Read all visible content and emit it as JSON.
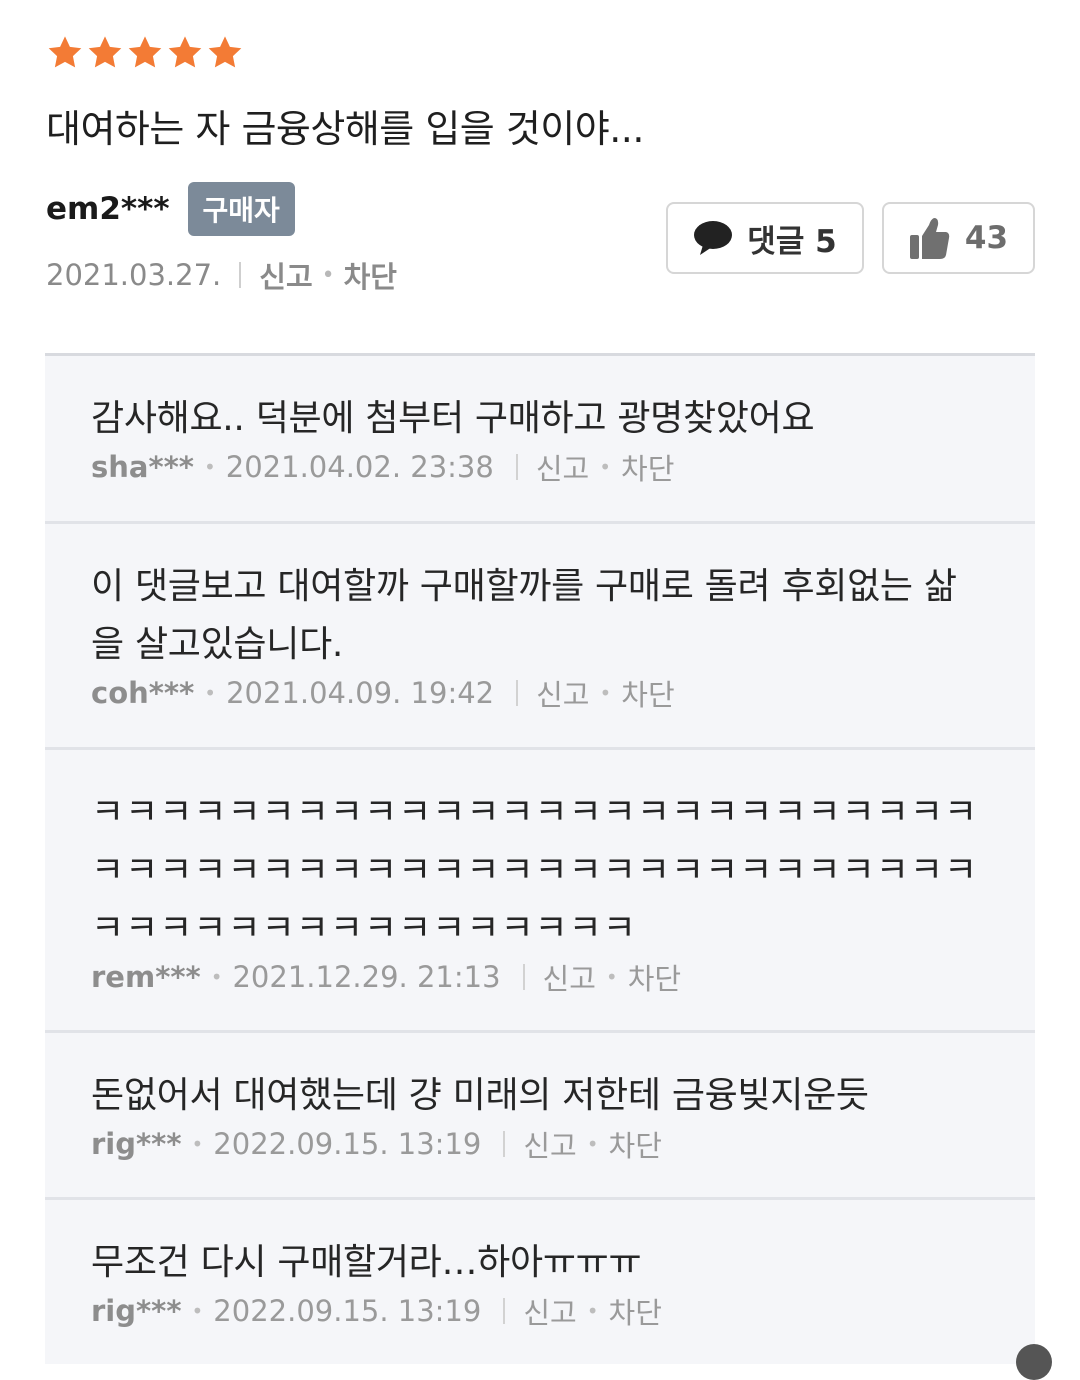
{
  "review": {
    "rating": 5,
    "rating_max": 5,
    "star_color": "#f37b35",
    "title": "대여하는 자 금융상해를 입을 것이야...",
    "author": "em2***",
    "badge": "구매자",
    "date": "2021.03.27.",
    "report": "신고",
    "block": "차단",
    "comments_button": "댓글 5",
    "like_count": "43"
  },
  "comments": [
    {
      "text": "감사해요.. 덕분에 첨부터 구매하고 광명찾았어요",
      "author": "sha***",
      "datetime": "2021.04.02. 23:38",
      "report": "신고",
      "block": "차단"
    },
    {
      "text": "이 댓글보고 대여할까 구매할까를 구매로 돌려 후회없는 삶을 살고있습니다.",
      "author": "coh***",
      "datetime": "2021.04.09. 19:42",
      "report": "신고",
      "block": "차단"
    },
    {
      "text": "ㅋㅋㅋㅋㅋㅋㅋㅋㅋㅋㅋㅋㅋㅋㅋㅋㅋㅋㅋㅋㅋㅋㅋㅋㅋㅋㅋㅋㅋㅋㅋㅋㅋㅋㅋㅋㅋㅋㅋㅋㅋㅋㅋㅋㅋㅋㅋㅋㅋㅋㅋㅋㅋㅋㅋㅋㅋㅋㅋㅋㅋㅋㅋㅋㅋㅋㅋㅋ",
      "author": "rem***",
      "datetime": "2021.12.29. 21:13",
      "report": "신고",
      "block": "차단"
    },
    {
      "text": "돈없어서 대여했는데 걍 미래의 저한테 금융빚지운듯",
      "author": "rig***",
      "datetime": "2022.09.15. 13:19",
      "report": "신고",
      "block": "차단"
    },
    {
      "text": "무조건 다시 구매할거라…하아ㅠㅠㅠ",
      "author": "rig***",
      "datetime": "2022.09.15. 13:19",
      "report": "신고",
      "block": "차단"
    }
  ]
}
